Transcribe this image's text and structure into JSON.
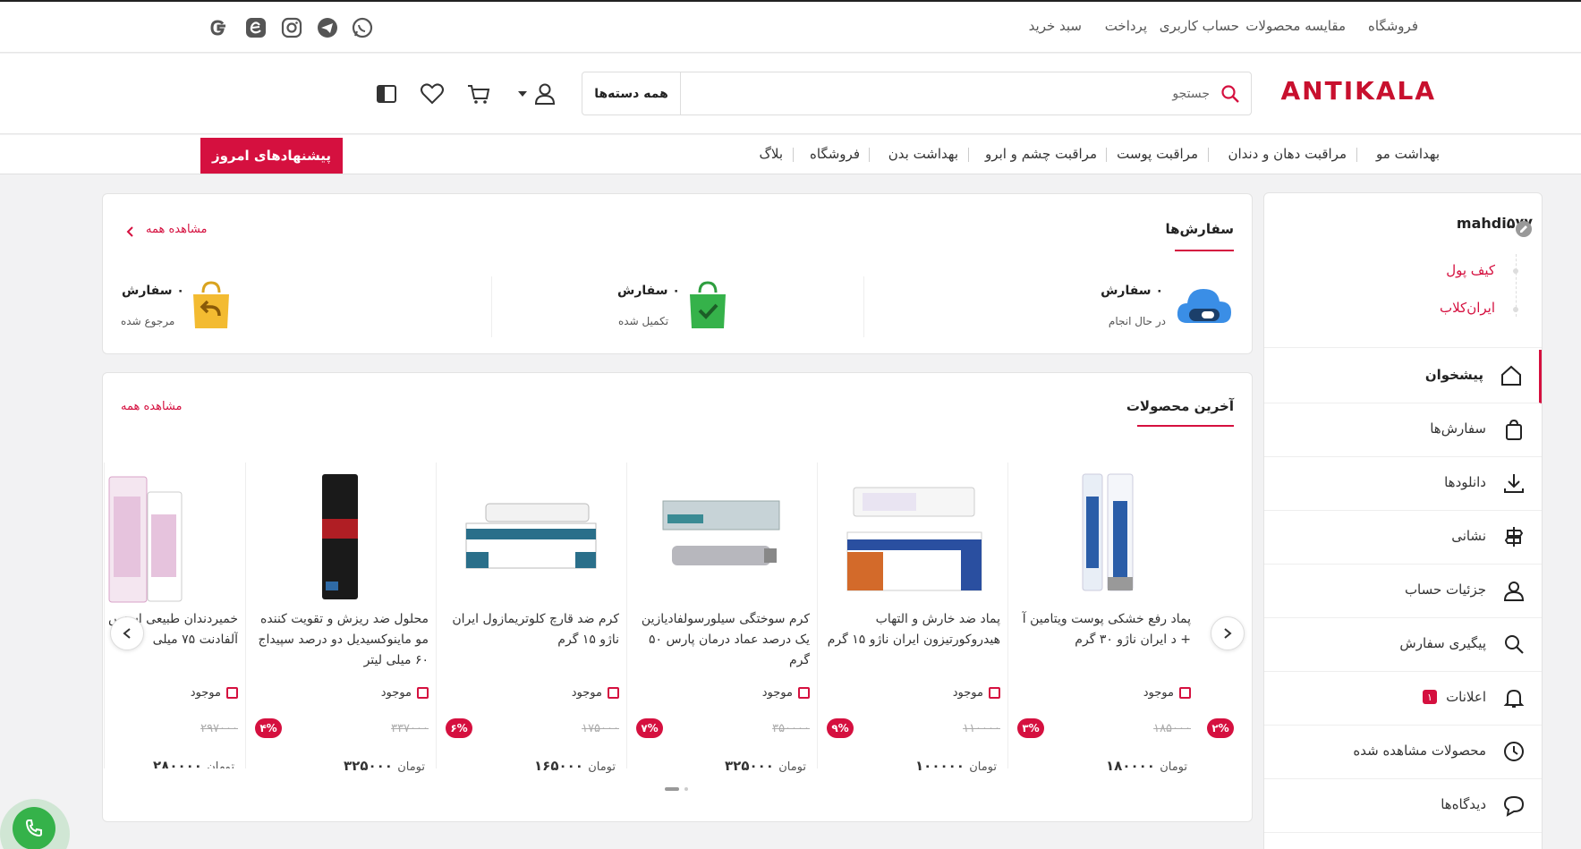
{
  "topbar": {
    "links": [
      "فروشگاه",
      "مقایسه محصولات",
      "حساب کاربری",
      "پرداخت",
      "سبد خرید"
    ],
    "social_icons": [
      "whatsapp-icon",
      "telegram-icon",
      "instagram-icon",
      "eitaa-icon",
      "google-icon"
    ]
  },
  "header": {
    "logo": "ANTIKALA",
    "search_placeholder": "جستجو",
    "category_select": "همه دسته‌ها"
  },
  "nav": {
    "items": [
      "بهداشت مو",
      "مراقبت دهان و دندان",
      "مراقبت پوست",
      "مراقبت چشم و ابرو",
      "بهداشت بدن",
      "فروشگاه",
      "بلاگ"
    ],
    "deals_button": "پیشنهادهای امروز"
  },
  "sidebar": {
    "username": "mahdi۵۷۷",
    "sub_links": [
      "کیف پول",
      "ایران‌کلاب"
    ],
    "items": [
      {
        "label": "پیشخوان",
        "icon": "home-icon"
      },
      {
        "label": "سفارش‌ها",
        "icon": "bag-icon"
      },
      {
        "label": "دانلودها",
        "icon": "download-icon"
      },
      {
        "label": "نشانی",
        "icon": "signpost-icon"
      },
      {
        "label": "جزئیات حساب",
        "icon": "user-icon"
      },
      {
        "label": "پیگیری سفارش",
        "icon": "search-icon"
      },
      {
        "label": "اعلانات",
        "icon": "bell-icon",
        "badge": "۱"
      },
      {
        "label": "محصولات مشاهده شده",
        "icon": "clock-icon"
      },
      {
        "label": "دیدگاه‌ها",
        "icon": "comment-icon"
      }
    ]
  },
  "orders": {
    "title": "سفارش‌ها",
    "view_all": "مشاهده همه",
    "stats": [
      {
        "count": "۰ سفارش",
        "label": "در حال انجام"
      },
      {
        "count": "۰ سفارش",
        "label": "تکمیل شده"
      },
      {
        "count": "۰ سفارش",
        "label": "مرجوع شده"
      }
    ]
  },
  "latest": {
    "title": "آخرین محصولات",
    "view_all": "مشاهده همه",
    "products": [
      {
        "name": "پماد رفع خشکی پوست ویتامین آ + د ایران ناژو ۳۰ گرم",
        "stock": "موجود",
        "old_price": "۱۸۵۰۰۰",
        "discount": "۳%",
        "price": "۱۸۰۰۰۰",
        "currency": "تومان"
      },
      {
        "name": "پماد ضد خارش و التهاب هیدروکورتیزون ایران ناژو ۱۵ گرم",
        "stock": "موجود",
        "old_price": "۱۱۰۰۰۰",
        "discount": "۹%",
        "price": "۱۰۰۰۰۰",
        "currency": "تومان"
      },
      {
        "name": "کرم سوختگی سیلورسولفادیازین یک درصد عماد درمان پارس ۵۰ گرم",
        "stock": "موجود",
        "old_price": "۳۵۰۰۰۰",
        "discount": "۷%",
        "price": "۳۲۵۰۰۰",
        "currency": "تومان"
      },
      {
        "name": "کرم ضد قارچ کلوتریمازول ایران ناژو ۱۵ گرم",
        "stock": "موجود",
        "old_price": "۱۷۵۰۰۰",
        "discount": "۶%",
        "price": "۱۶۵۰۰۰",
        "currency": "تومان"
      },
      {
        "name": "محلول ضد ریزش و تقویت کننده مو ماینوکسیدیل دو درصد سپیداج ۶۰ میلی لیتر",
        "stock": "موجود",
        "old_price": "۳۳۷۰۰۰",
        "discount": "۴%",
        "price": "۳۲۵۰۰۰",
        "currency": "تومان"
      },
      {
        "name": "خمیردندان طبیعی اسنس آلفادنت ۷۵ میلی",
        "stock": "موجود",
        "old_price": "۲۹۷۰۰۰",
        "discount": "",
        "price": "۲۸۰۰۰۰",
        "currency": "تومان"
      }
    ],
    "partial_right_discount": "۲%"
  },
  "colors": {
    "accent": "#d5103f",
    "logo": "#c8102e",
    "green": "#35b24a"
  }
}
